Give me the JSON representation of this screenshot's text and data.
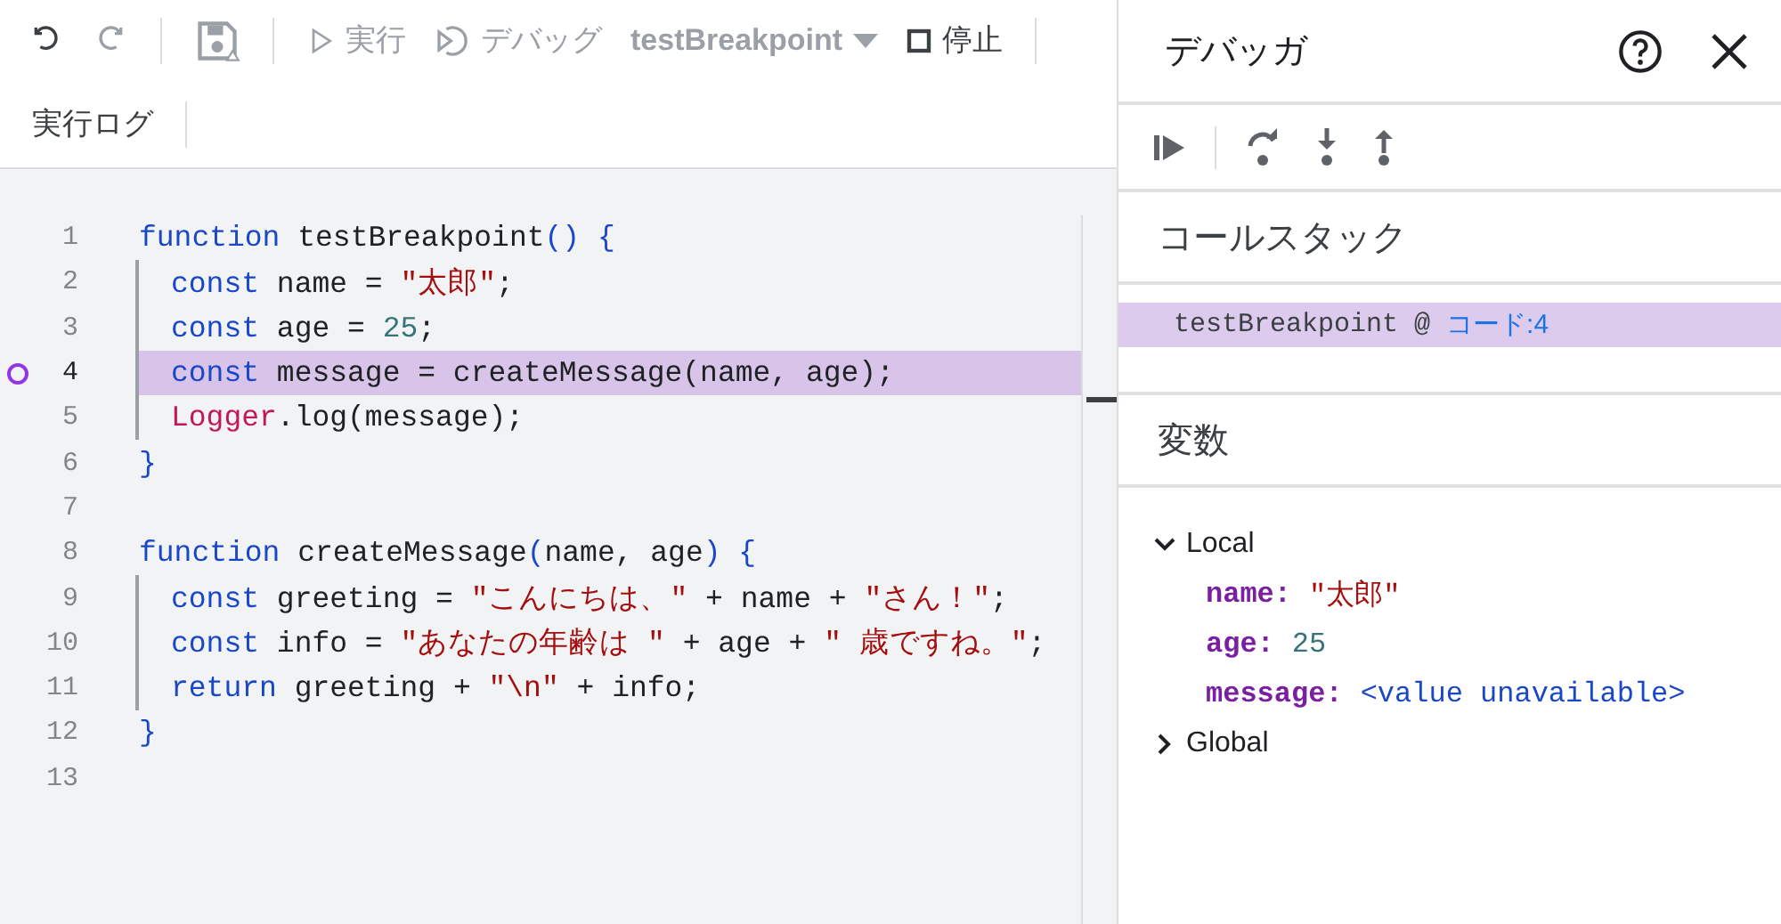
{
  "toolbar": {
    "items": [
      {
        "kind": "undo",
        "disabled": false
      },
      {
        "kind": "redo",
        "disabled": true
      },
      {
        "kind": "separator"
      },
      {
        "kind": "save",
        "disabled": true
      },
      {
        "kind": "separator"
      },
      {
        "kind": "run",
        "label": "実行",
        "disabled": true
      },
      {
        "kind": "debug",
        "label": "デバッグ",
        "disabled": true
      },
      {
        "kind": "function-select",
        "label": "testBreakpoint",
        "disabled": true
      },
      {
        "kind": "stop",
        "label": "停止",
        "disabled": false
      },
      {
        "kind": "separator"
      }
    ],
    "log_button": "実行ログ"
  },
  "editor": {
    "lines": [
      {
        "number": "1",
        "indented": false,
        "breakpoint": false,
        "current": false,
        "tokens": [
          {
            "kind": "kw",
            "text": "function"
          },
          {
            "kind": "plain",
            "text": " testBreakpoint"
          },
          {
            "kind": "kw",
            "text": "() {"
          }
        ]
      },
      {
        "number": "2",
        "indented": true,
        "breakpoint": false,
        "current": false,
        "tokens": [
          {
            "kind": "kw",
            "text": "const"
          },
          {
            "kind": "plain",
            "text": " name = "
          },
          {
            "kind": "str",
            "text": "\"太郎\""
          },
          {
            "kind": "plain",
            "text": ";"
          }
        ]
      },
      {
        "number": "3",
        "indented": true,
        "breakpoint": false,
        "current": false,
        "tokens": [
          {
            "kind": "kw",
            "text": "const"
          },
          {
            "kind": "plain",
            "text": " age = "
          },
          {
            "kind": "num",
            "text": "25"
          },
          {
            "kind": "plain",
            "text": ";"
          }
        ]
      },
      {
        "number": "4",
        "indented": true,
        "breakpoint": true,
        "current": true,
        "tokens": [
          {
            "kind": "kw",
            "text": "const"
          },
          {
            "kind": "plain",
            "text": " message = createMessage(name, age);"
          }
        ]
      },
      {
        "number": "5",
        "indented": true,
        "breakpoint": false,
        "current": false,
        "tokens": [
          {
            "kind": "cls",
            "text": "Logger"
          },
          {
            "kind": "plain",
            "text": ".log(message);"
          }
        ]
      },
      {
        "number": "6",
        "indented": false,
        "breakpoint": false,
        "current": false,
        "tokens": [
          {
            "kind": "kw",
            "text": "}"
          }
        ]
      },
      {
        "number": "7",
        "indented": false,
        "breakpoint": false,
        "current": false
      },
      {
        "number": "8",
        "indented": false,
        "breakpoint": false,
        "current": false,
        "tokens": [
          {
            "kind": "kw",
            "text": "function"
          },
          {
            "kind": "plain",
            "text": " createMessage"
          },
          {
            "kind": "kw",
            "text": "("
          },
          {
            "kind": "plain",
            "text": "name, age"
          },
          {
            "kind": "kw",
            "text": ") {"
          }
        ]
      },
      {
        "number": "9",
        "indented": true,
        "breakpoint": false,
        "current": false,
        "tokens": [
          {
            "kind": "kw",
            "text": "const"
          },
          {
            "kind": "plain",
            "text": " greeting = "
          },
          {
            "kind": "str",
            "text": "\"こんにちは、\""
          },
          {
            "kind": "plain",
            "text": " + name + "
          },
          {
            "kind": "str",
            "text": "\"さん！\""
          },
          {
            "kind": "plain",
            "text": ";"
          }
        ]
      },
      {
        "number": "10",
        "indented": true,
        "breakpoint": false,
        "current": false,
        "tokens": [
          {
            "kind": "kw",
            "text": "const"
          },
          {
            "kind": "plain",
            "text": " info = "
          },
          {
            "kind": "str",
            "text": "\"あなたの年齢は \""
          },
          {
            "kind": "plain",
            "text": " + age + "
          },
          {
            "kind": "str",
            "text": "\" 歳ですね。\""
          },
          {
            "kind": "plain",
            "text": ";"
          }
        ]
      },
      {
        "number": "11",
        "indented": true,
        "breakpoint": false,
        "current": false,
        "tokens": [
          {
            "kind": "kw",
            "text": "return"
          },
          {
            "kind": "plain",
            "text": " greeting + "
          },
          {
            "kind": "str",
            "text": "\"\\n\""
          },
          {
            "kind": "plain",
            "text": " + info;"
          }
        ]
      },
      {
        "number": "12",
        "indented": false,
        "breakpoint": false,
        "current": false,
        "tokens": [
          {
            "kind": "kw",
            "text": "}"
          }
        ]
      },
      {
        "number": "13",
        "indented": false,
        "breakpoint": false,
        "current": false
      }
    ]
  },
  "debugger": {
    "title": "デバッガ",
    "controls": [
      {
        "kind": "resume"
      },
      {
        "kind": "separator"
      },
      {
        "kind": "step-over"
      },
      {
        "kind": "step-into"
      },
      {
        "kind": "step-out"
      }
    ],
    "call_stack": {
      "title": "コールスタック",
      "frames": [
        {
          "function": "testBreakpoint @ ",
          "location": "コード:4",
          "selected": true
        }
      ]
    },
    "variables": {
      "title": "変数",
      "scopes": [
        {
          "name": "Local",
          "expanded": true,
          "children": [
            {
              "name": "name:",
              "value": "\"太郎\"",
              "kind": "string"
            },
            {
              "name": "age:",
              "value": "25",
              "kind": "number"
            },
            {
              "name": "message:",
              "value": "<value unavailable>",
              "kind": "unavailable"
            }
          ]
        },
        {
          "name": "Global",
          "expanded": false
        }
      ]
    }
  }
}
